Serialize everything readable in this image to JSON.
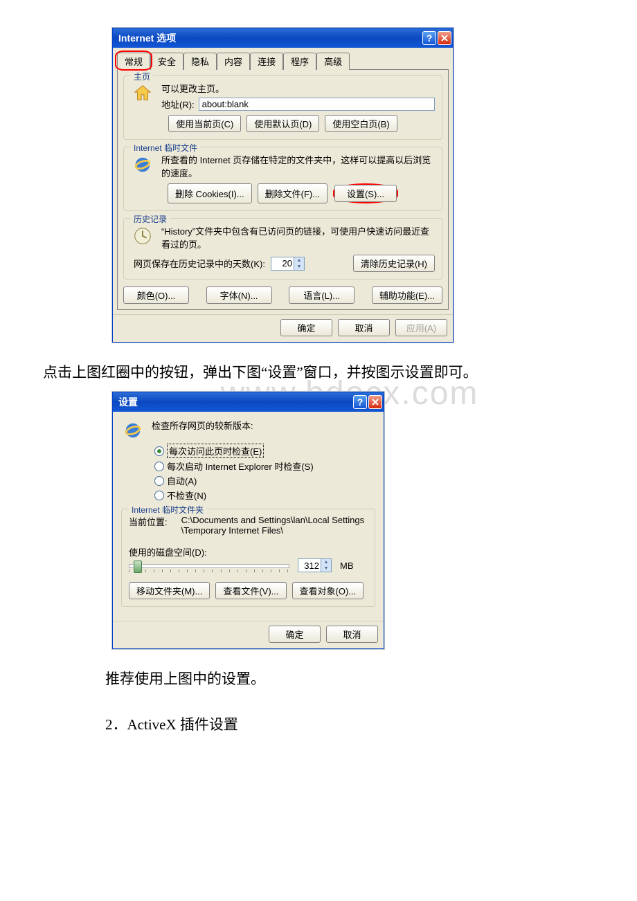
{
  "doc": {
    "para1": "点击上图红圈中的按钮，弹出下图“设置”窗口，并按图示设置即可。",
    "para2": "推荐使用上图中的设置。",
    "para3": "2．ActiveX 插件设置",
    "watermark": "www.bdocx.com"
  },
  "dialog1": {
    "title": "Internet 选项",
    "tabs": [
      "常规",
      "安全",
      "隐私",
      "内容",
      "连接",
      "程序",
      "高级"
    ],
    "home": {
      "legend": "主页",
      "desc": "可以更改主页。",
      "addr_label": "地址(R):",
      "addr_value": "about:blank",
      "btn_current": "使用当前页(C)",
      "btn_default": "使用默认页(D)",
      "btn_blank": "使用空白页(B)"
    },
    "temp": {
      "legend": "Internet 临时文件",
      "desc": "所查看的 Internet 页存储在特定的文件夹中，这样可以提高以后浏览的速度。",
      "btn_cookies": "删除 Cookies(I)...",
      "btn_files": "删除文件(F)...",
      "btn_settings": "设置(S)..."
    },
    "history": {
      "legend": "历史记录",
      "desc": "“History”文件夹中包含有已访问页的链接，可使用户快速访问最近查看过的页。",
      "days_label": "网页保存在历史记录中的天数(K):",
      "days_value": "20",
      "btn_clear": "清除历史记录(H)"
    },
    "footer_btns": {
      "colors": "颜色(O)...",
      "fonts": "字体(N)...",
      "lang": "语言(L)...",
      "access": "辅助功能(E)..."
    },
    "actions": {
      "ok": "确定",
      "cancel": "取消",
      "apply": "应用(A)"
    }
  },
  "dialog2": {
    "title": "设置",
    "check_label": "检查所存网页的较新版本:",
    "radios": {
      "every_visit": "每次访问此页时检查(E)",
      "every_start": "每次启动 Internet Explorer 时检查(S)",
      "auto": "自动(A)",
      "never": "不检查(N)"
    },
    "temp": {
      "legend": "Internet 临时文件夹",
      "loc_label": "当前位置:",
      "loc_value": "C:\\Documents and Settings\\lan\\Local Settings\\Temporary Internet Files\\",
      "disk_label": "使用的磁盘空间(D):",
      "disk_value": "312",
      "disk_unit": "MB",
      "btn_move": "移动文件夹(M)...",
      "btn_view": "查看文件(V)...",
      "btn_obj": "查看对象(O)..."
    },
    "actions": {
      "ok": "确定",
      "cancel": "取消"
    }
  }
}
